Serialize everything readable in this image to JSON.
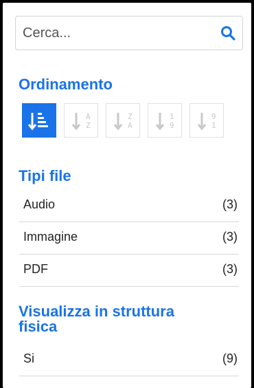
{
  "search": {
    "placeholder": "Cerca...",
    "icon": "search-icon"
  },
  "sorting": {
    "title": "Ordinamento",
    "buttons": [
      {
        "name": "sort-relevance-button",
        "icon": "sort-relevance-icon",
        "active": true
      },
      {
        "name": "sort-alpha-asc-button",
        "icon": "sort-alpha-asc-icon",
        "top": "A",
        "bottom": "Z",
        "active": false
      },
      {
        "name": "sort-alpha-desc-button",
        "icon": "sort-alpha-desc-icon",
        "top": "Z",
        "bottom": "A",
        "active": false
      },
      {
        "name": "sort-numeric-asc-button",
        "icon": "sort-numeric-asc-icon",
        "top": "1",
        "bottom": "9",
        "active": false
      },
      {
        "name": "sort-numeric-desc-button",
        "icon": "sort-numeric-desc-icon",
        "top": "9",
        "bottom": "1",
        "active": false
      }
    ]
  },
  "file_types": {
    "title": "Tipi file",
    "items": [
      {
        "label": "Audio",
        "count": "(3)"
      },
      {
        "label": "Immagine",
        "count": "(3)"
      },
      {
        "label": "PDF",
        "count": "(3)"
      }
    ]
  },
  "physical_structure": {
    "title_line1": "Visualizza in struttura",
    "title_line2": "fisica",
    "items": [
      {
        "label": "Si",
        "count": "(9)"
      }
    ]
  },
  "colors": {
    "accent": "#1a73e8",
    "border": "#d4d4d4",
    "text": "#222222",
    "inactive_icon": "#c8c8c8"
  }
}
